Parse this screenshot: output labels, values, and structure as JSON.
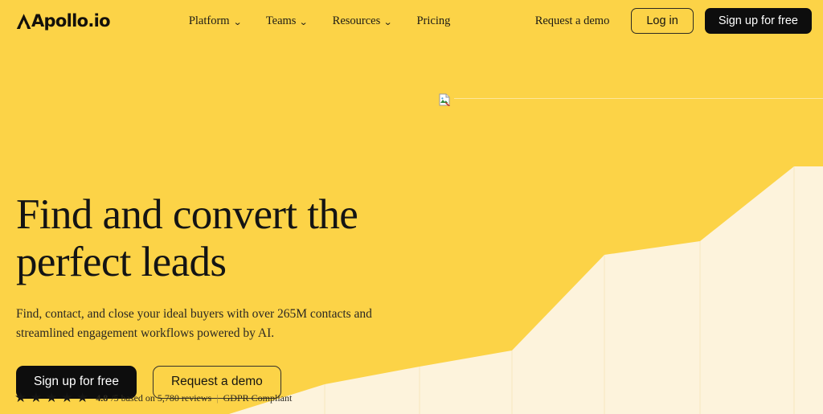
{
  "brand": {
    "logo_text": "Apollo.io",
    "logo_icon": "apollo-triangle-mark",
    "background_color": "#FCD347",
    "chart_fill_color": "#FDF3DC",
    "dark_button_color": "#0D0D0D"
  },
  "header": {
    "nav": [
      {
        "label": "Platform",
        "caret": "⌄",
        "has_dropdown": true
      },
      {
        "label": "Teams",
        "caret": "⌄",
        "has_dropdown": true
      },
      {
        "label": "Resources",
        "caret": "⌄",
        "has_dropdown": true
      },
      {
        "label": "Pricing",
        "caret": "",
        "has_dropdown": false
      }
    ],
    "request_demo_label": "Request a demo",
    "login_label": "Log in",
    "signup_label": "Sign up for free"
  },
  "hero": {
    "title_line_1": "Find and convert the",
    "title_line_2": "perfect leads",
    "subtitle": "Find, contact, and close your ideal buyers with over 265M contacts and streamlined engagement workflows powered by AI.",
    "primary_cta": "Sign up for free",
    "secondary_cta": "Request a demo"
  },
  "rating": {
    "star_glyph": "★",
    "star_count": 5,
    "score": "4.8",
    "score_suffix": "/5 based on 5,780 reviews",
    "divider": "|",
    "compliance": "GDPR Compliant"
  },
  "broken_image": {
    "icon": "broken-image-icon",
    "alt": ""
  },
  "chart_data": {
    "type": "area",
    "title": "",
    "xlabel": "",
    "ylabel": "",
    "grid": false,
    "legend": false,
    "axis_note": "decorative background growth curve; y measured as px from top of 515px canvas",
    "xlim": [
      285,
      1024
    ],
    "ylim": [
      515,
      200
    ],
    "vertical_dividers_x": [
      404,
      522,
      637,
      752,
      871,
      988
    ],
    "points": [
      {
        "x": 285,
        "y": 515
      },
      {
        "x": 404,
        "y": 478
      },
      {
        "x": 522,
        "y": 456
      },
      {
        "x": 637,
        "y": 436
      },
      {
        "x": 752,
        "y": 317
      },
      {
        "x": 871,
        "y": 300
      },
      {
        "x": 988,
        "y": 207
      },
      {
        "x": 1024,
        "y": 207
      }
    ]
  }
}
